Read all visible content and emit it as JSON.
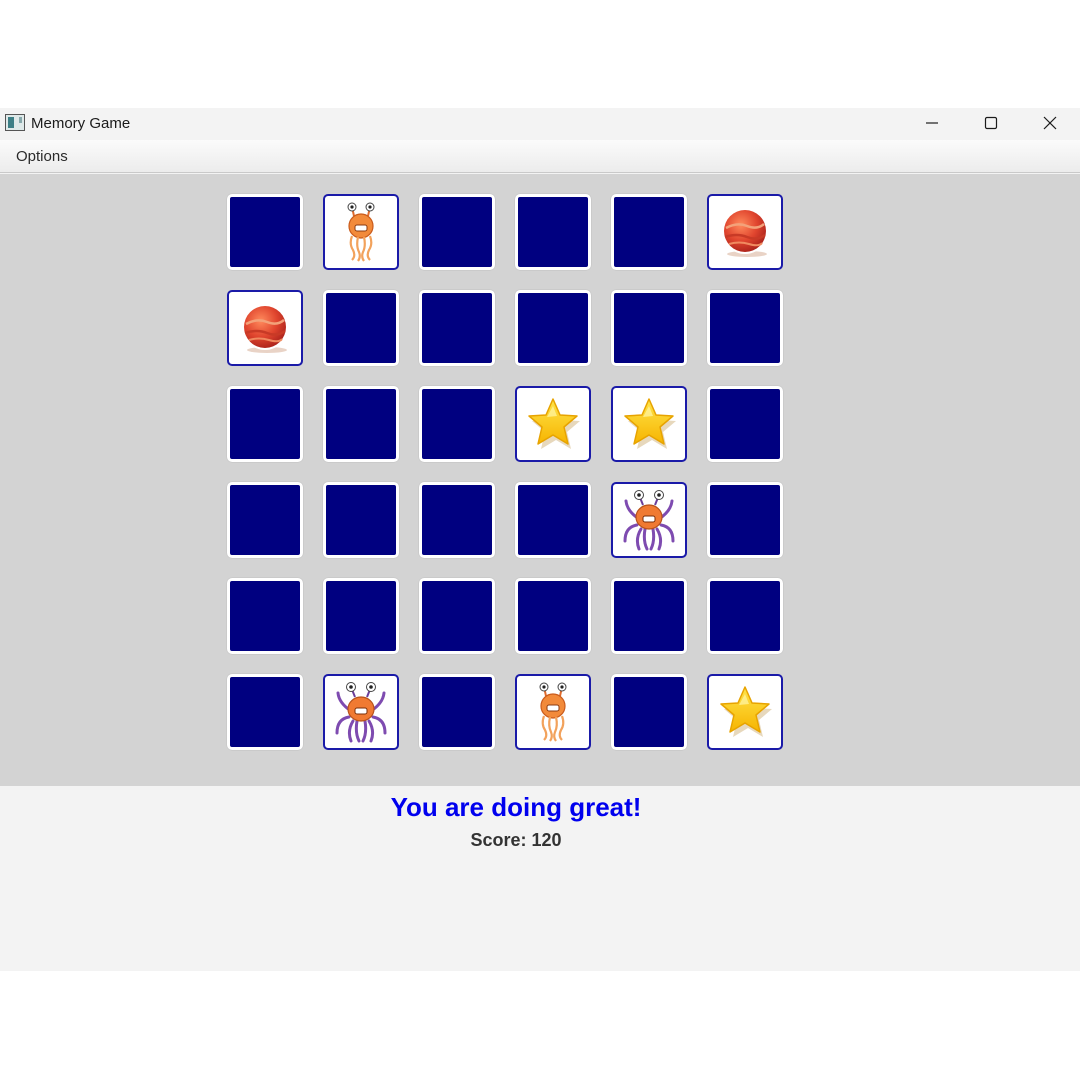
{
  "window": {
    "title": "Memory Game",
    "controls": [
      "minimize-icon",
      "maximize-icon",
      "close-icon"
    ]
  },
  "menu": {
    "items": [
      "Options"
    ]
  },
  "board": {
    "rows": 6,
    "cols": 6,
    "card_back_color": "#000080",
    "card_border_color": "#1a1aa8",
    "cards": [
      "hidden",
      "jellyfish-monster",
      "hidden",
      "hidden",
      "hidden",
      "red-ball",
      "red-ball",
      "hidden",
      "hidden",
      "hidden",
      "hidden",
      "hidden",
      "hidden",
      "hidden",
      "hidden",
      "star",
      "star",
      "hidden",
      "hidden",
      "hidden",
      "hidden",
      "hidden",
      "octopus-monster",
      "hidden",
      "hidden",
      "hidden",
      "hidden",
      "hidden",
      "hidden",
      "hidden",
      "hidden",
      "octopus-monster",
      "hidden",
      "jellyfish-monster",
      "hidden",
      "star"
    ]
  },
  "status": {
    "message": "You are doing great!",
    "score_text": "Score: 120",
    "message_color": "#0000ee"
  }
}
